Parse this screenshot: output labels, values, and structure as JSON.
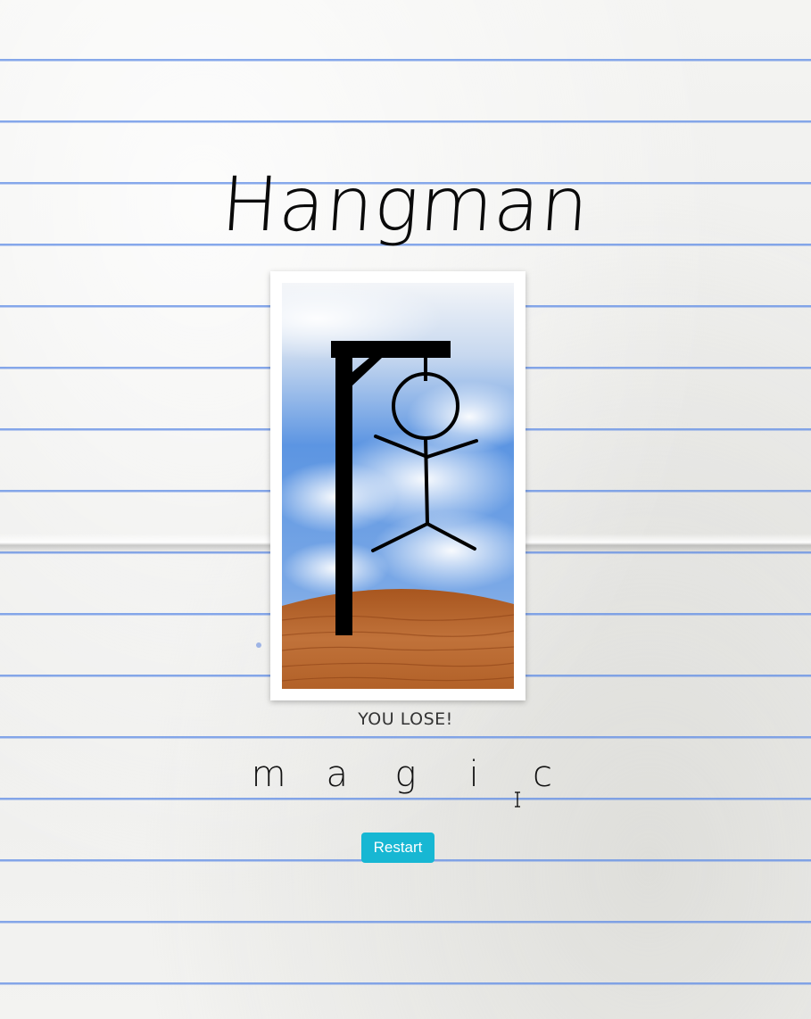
{
  "game": {
    "title": "Hangman",
    "status": "YOU LOSE!",
    "word_letters": [
      "m",
      "a",
      "g",
      "i",
      "c"
    ],
    "restart_label": "Restart",
    "wrong_guesses_shown": 6,
    "max_wrong_guesses": 6
  },
  "colors": {
    "restart_button": "#17b7d3",
    "paper": "#f1f1ef",
    "rule_line": "#5f8ce6",
    "sky": "#4f8fe0",
    "ground": "#b5652a",
    "gallows": "#000000"
  },
  "icons": {
    "cursor": "text-cursor-icon"
  }
}
